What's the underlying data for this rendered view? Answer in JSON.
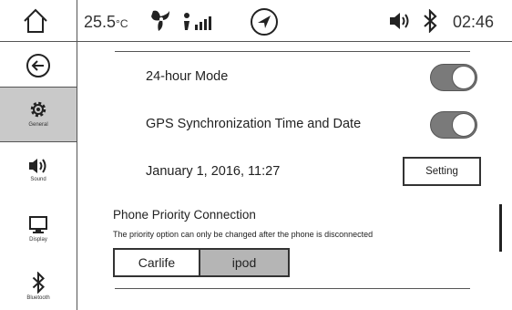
{
  "status_bar": {
    "temperature": "25.5",
    "temperature_unit": "°C",
    "time": "02:46",
    "icons": [
      "home-icon",
      "fan-icon",
      "signal-icon",
      "navigation-icon",
      "volume-icon",
      "bluetooth-icon"
    ]
  },
  "sidebar": {
    "items": [
      {
        "name": "back",
        "label": ""
      },
      {
        "name": "general",
        "label": "General",
        "selected": true
      },
      {
        "name": "sound",
        "label": "Sound"
      },
      {
        "name": "display",
        "label": "Display"
      },
      {
        "name": "bluetooth",
        "label": "Bluetooth"
      }
    ]
  },
  "main": {
    "hour_mode": {
      "label": "24-hour Mode",
      "enabled": true
    },
    "gps_sync": {
      "label": "GPS Synchronization Time and Date",
      "enabled": true
    },
    "date_time": {
      "value": "January 1, 2016, 11:27",
      "button": "Setting"
    },
    "phone_priority": {
      "title": "Phone Priority Connection",
      "note": "The priority option can only be changed after the phone is disconnected",
      "options": [
        "Carlife",
        "ipod"
      ],
      "selected": "ipod"
    }
  },
  "colors": {
    "selected_bg": "#c9c9c9",
    "toggle_on": "#7a7a7a",
    "segment_selected": "#b5b5b5"
  }
}
